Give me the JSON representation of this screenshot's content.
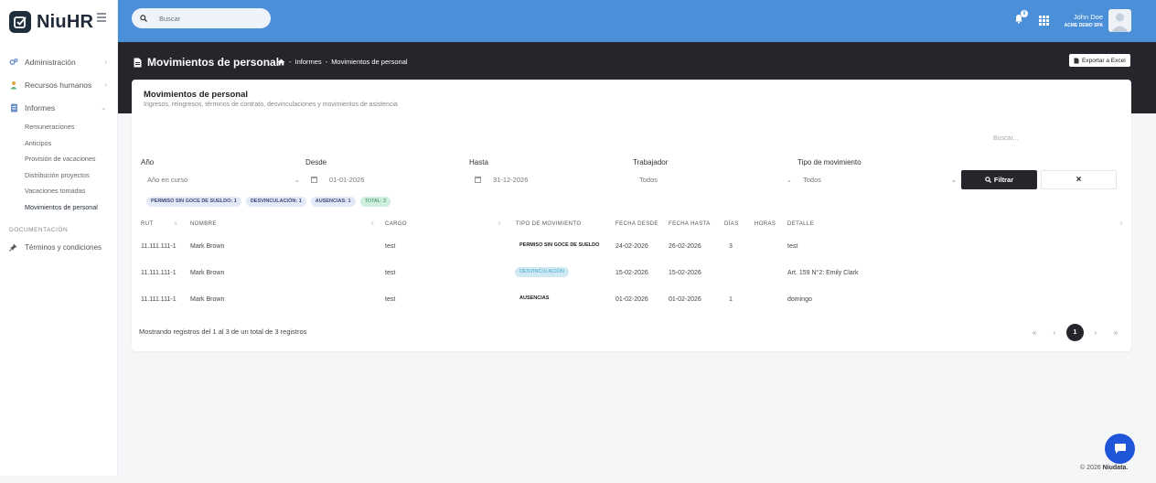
{
  "brand": {
    "name": "NiuHR"
  },
  "topbar": {
    "search_placeholder": "Buscar",
    "notification_count": "0",
    "user_name": "John Doe",
    "company": "ACME DEMO SPA",
    "accent": "#4a8fd8"
  },
  "sidebar": {
    "items": [
      {
        "label": "Administración",
        "icon": "gears-icon"
      },
      {
        "label": "Recursos humanos",
        "icon": "user-icon"
      },
      {
        "label": "Informes",
        "icon": "document-icon"
      }
    ],
    "informes_sub": [
      "Remuneraciones",
      "Anticipos",
      "Provisión de vacaciones",
      "Distribución proyectos",
      "Vacaciones tomadas",
      "Movimientos de personal"
    ],
    "doc_section": "DOCUMENTACIÓN",
    "doc_item": "Términos y condiciones"
  },
  "header": {
    "title": "Movimientos de personal",
    "breadcrumb": [
      "Informes",
      "Movimientos de personal"
    ],
    "export_label": "Exportar a Excel"
  },
  "card": {
    "title": "Movimientos de personal",
    "subtitle": "Ingresos, reingresos, términos de contrato, desvinculaciones y movimientos de asistencia",
    "search_label": "Buscar..."
  },
  "filters": {
    "year_label": "Año",
    "year_value": "Año en curso",
    "from_label": "Desde",
    "from_value": "01-01-2026",
    "to_label": "Hasta",
    "to_value": "31-12-2026",
    "worker_label": "Trabajador",
    "worker_value": "Todos",
    "type_label": "Tipo de movimiento",
    "type_value": "Todos",
    "filter_button": "Filtrar",
    "clear_button": "×"
  },
  "chips": [
    "PERMISO SIN GOCE DE SUELDO: 1",
    "DESVINCULACIÓN: 1",
    "AUSENCIAS: 1",
    "TOTAL: 3"
  ],
  "table": {
    "columns": [
      "RUT",
      "NOMBRE",
      "CARGO",
      "TIPO DE MOVIMIENTO",
      "FECHA DESDE",
      "FECHA HASTA",
      "DÍAS",
      "HORAS",
      "DETALLE"
    ],
    "rows": [
      {
        "rut": "11.111.111-1",
        "nombre": "Mark Brown",
        "cargo": "test",
        "tipo": "PERMISO SIN GOCE DE SUELDO",
        "desde": "24-02-2026",
        "hasta": "26-02-2026",
        "dias": "3",
        "horas": "",
        "detalle": "test"
      },
      {
        "rut": "11.111.111-1",
        "nombre": "Mark Brown",
        "cargo": "test",
        "tipo": "DESVINCULACIÓN",
        "desde": "15-02-2026",
        "hasta": "15-02-2026",
        "dias": "",
        "horas": "",
        "detalle": "Art. 159 N°2: Emily Clark"
      },
      {
        "rut": "11.111.111-1",
        "nombre": "Mark Brown",
        "cargo": "test",
        "tipo": "AUSENCIAS",
        "desde": "01-02-2026",
        "hasta": "01-02-2026",
        "dias": "1",
        "horas": "",
        "detalle": "domingo"
      }
    ]
  },
  "pagination": {
    "summary": "Mostrando registros del 1 al 3 de un total de 3 registros",
    "first": "«",
    "prev": "‹",
    "current": "1",
    "next": "›",
    "last": "»"
  },
  "footer": {
    "copyright": "© 2026 ",
    "brand": "Niudata."
  }
}
